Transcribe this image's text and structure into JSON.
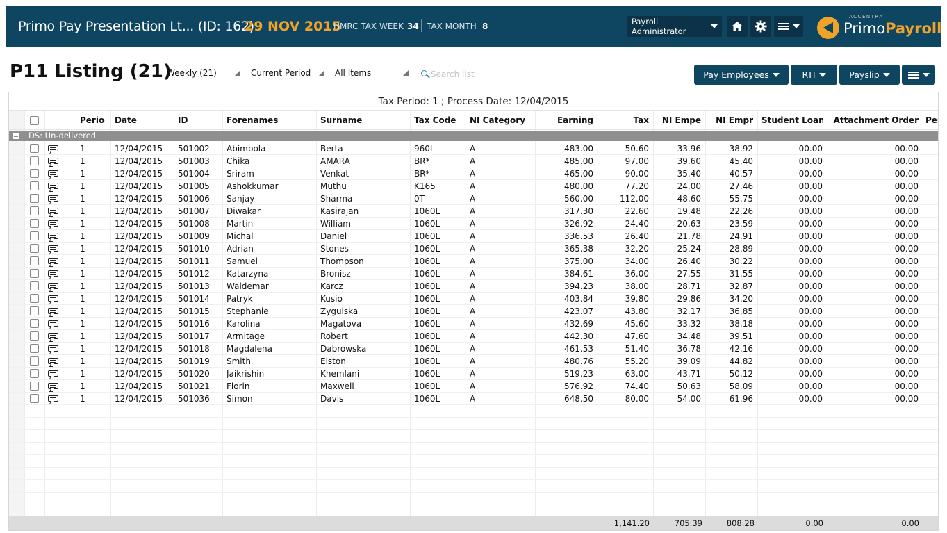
{
  "header": {
    "company": "Primo Pay Presentation Lt... (ID: 162)",
    "date": "29 NOV 2015",
    "tax_week_label": "HMRC TAX WEEK",
    "tax_week": "34",
    "tax_month_label": "TAX MONTH",
    "tax_month": "8",
    "role": "Payroll Administrator",
    "logo_sup": "ACCENTRA",
    "logo_primo": "Primo",
    "logo_payroll": "Payroll",
    "icons": {
      "home": "home-icon",
      "settings": "gear-icon",
      "menu": "menu-icon"
    }
  },
  "toolbar": {
    "title": "P11 Listing (21)",
    "filters": [
      "Weekly (21)",
      "Current Period",
      "All Items"
    ],
    "search_placeholder": "Search list",
    "buttons": {
      "pay_employees": "Pay Employees",
      "rti": "RTI",
      "payslip": "Payslip"
    }
  },
  "grid": {
    "caption": "Tax Period: 1 ; Process Date: 12/04/2015",
    "columns": [
      "Period",
      "Date",
      "ID",
      "Forenames",
      "Surname",
      "Tax Code",
      "NI Category",
      "Earning",
      "Tax",
      "NI Empe",
      "NI Empr",
      "Student Loan",
      "Attachment Order",
      "Per"
    ],
    "group": "DS: Un-delivered",
    "rows": [
      {
        "period": "1",
        "date": "12/04/2015",
        "id": "501002",
        "forenames": "Abimbola",
        "surname": "Berta",
        "tax_code": "960L",
        "ni_cat": "A",
        "earning": "483.00",
        "tax": "50.60",
        "ni_empe": "33.96",
        "ni_empr": "38.92",
        "student_loan": "00.00",
        "attachment": "00.00"
      },
      {
        "period": "1",
        "date": "12/04/2015",
        "id": "501003",
        "forenames": "Chika",
        "surname": "AMARA",
        "tax_code": "BR*",
        "ni_cat": "A",
        "earning": "485.00",
        "tax": "97.00",
        "ni_empe": "39.60",
        "ni_empr": "45.40",
        "student_loan": "00.00",
        "attachment": "00.00"
      },
      {
        "period": "1",
        "date": "12/04/2015",
        "id": "501004",
        "forenames": "Sriram",
        "surname": "Venkat",
        "tax_code": "BR*",
        "ni_cat": "A",
        "earning": "465.00",
        "tax": "90.00",
        "ni_empe": "35.40",
        "ni_empr": "40.57",
        "student_loan": "00.00",
        "attachment": "00.00"
      },
      {
        "period": "1",
        "date": "12/04/2015",
        "id": "501005",
        "forenames": "Ashokkumar",
        "surname": "Muthu",
        "tax_code": "K165",
        "ni_cat": "A",
        "earning": "480.00",
        "tax": "77.20",
        "ni_empe": "24.00",
        "ni_empr": "27.46",
        "student_loan": "00.00",
        "attachment": "00.00"
      },
      {
        "period": "1",
        "date": "12/04/2015",
        "id": "501006",
        "forenames": "Sanjay",
        "surname": "Sharma",
        "tax_code": "0T",
        "ni_cat": "A",
        "earning": "560.00",
        "tax": "112.00",
        "ni_empe": "48.60",
        "ni_empr": "55.75",
        "student_loan": "00.00",
        "attachment": "00.00"
      },
      {
        "period": "1",
        "date": "12/04/2015",
        "id": "501007",
        "forenames": "Diwakar",
        "surname": "Kasirajan",
        "tax_code": "1060L",
        "ni_cat": "A",
        "earning": "317.30",
        "tax": "22.60",
        "ni_empe": "19.48",
        "ni_empr": "22.26",
        "student_loan": "00.00",
        "attachment": "00.00"
      },
      {
        "period": "1",
        "date": "12/04/2015",
        "id": "501008",
        "forenames": "Martin",
        "surname": "William",
        "tax_code": "1060L",
        "ni_cat": "A",
        "earning": "326.92",
        "tax": "24.40",
        "ni_empe": "20.63",
        "ni_empr": "23.59",
        "student_loan": "00.00",
        "attachment": "00.00"
      },
      {
        "period": "1",
        "date": "12/04/2015",
        "id": "501009",
        "forenames": "Michal",
        "surname": "Daniel",
        "tax_code": "1060L",
        "ni_cat": "A",
        "earning": "336.53",
        "tax": "26.40",
        "ni_empe": "21.78",
        "ni_empr": "24.91",
        "student_loan": "00.00",
        "attachment": "00.00"
      },
      {
        "period": "1",
        "date": "12/04/2015",
        "id": "501010",
        "forenames": "Adrian",
        "surname": "Stones",
        "tax_code": "1060L",
        "ni_cat": "A",
        "earning": "365.38",
        "tax": "32.20",
        "ni_empe": "25.24",
        "ni_empr": "28.89",
        "student_loan": "00.00",
        "attachment": "00.00"
      },
      {
        "period": "1",
        "date": "12/04/2015",
        "id": "501011",
        "forenames": "Samuel",
        "surname": "Thompson",
        "tax_code": "1060L",
        "ni_cat": "A",
        "earning": "375.00",
        "tax": "34.00",
        "ni_empe": "26.40",
        "ni_empr": "30.22",
        "student_loan": "00.00",
        "attachment": "00.00"
      },
      {
        "period": "1",
        "date": "12/04/2015",
        "id": "501012",
        "forenames": "Katarzyna",
        "surname": "Bronisz",
        "tax_code": "1060L",
        "ni_cat": "A",
        "earning": "384.61",
        "tax": "36.00",
        "ni_empe": "27.55",
        "ni_empr": "31.55",
        "student_loan": "00.00",
        "attachment": "00.00"
      },
      {
        "period": "1",
        "date": "12/04/2015",
        "id": "501013",
        "forenames": "Waldemar",
        "surname": "Karcz",
        "tax_code": "1060L",
        "ni_cat": "A",
        "earning": "394.23",
        "tax": "38.00",
        "ni_empe": "28.71",
        "ni_empr": "32.87",
        "student_loan": "00.00",
        "attachment": "00.00"
      },
      {
        "period": "1",
        "date": "12/04/2015",
        "id": "501014",
        "forenames": "Patryk",
        "surname": "Kusio",
        "tax_code": "1060L",
        "ni_cat": "A",
        "earning": "403.84",
        "tax": "39.80",
        "ni_empe": "29.86",
        "ni_empr": "34.20",
        "student_loan": "00.00",
        "attachment": "00.00"
      },
      {
        "period": "1",
        "date": "12/04/2015",
        "id": "501015",
        "forenames": "Stephanie",
        "surname": "Zygulska",
        "tax_code": "1060L",
        "ni_cat": "A",
        "earning": "423.07",
        "tax": "43.80",
        "ni_empe": "32.17",
        "ni_empr": "36.85",
        "student_loan": "00.00",
        "attachment": "00.00"
      },
      {
        "period": "1",
        "date": "12/04/2015",
        "id": "501016",
        "forenames": "Karolina",
        "surname": "Magatova",
        "tax_code": "1060L",
        "ni_cat": "A",
        "earning": "432.69",
        "tax": "45.60",
        "ni_empe": "33.32",
        "ni_empr": "38.18",
        "student_loan": "00.00",
        "attachment": "00.00"
      },
      {
        "period": "1",
        "date": "12/04/2015",
        "id": "501017",
        "forenames": "Armitage",
        "surname": "Robert",
        "tax_code": "1060L",
        "ni_cat": "A",
        "earning": "442.30",
        "tax": "47.60",
        "ni_empe": "34.48",
        "ni_empr": "39.51",
        "student_loan": "00.00",
        "attachment": "00.00"
      },
      {
        "period": "1",
        "date": "12/04/2015",
        "id": "501018",
        "forenames": "Magdalena",
        "surname": "Dabrowska",
        "tax_code": "1060L",
        "ni_cat": "A",
        "earning": "461.53",
        "tax": "51.40",
        "ni_empe": "36.78",
        "ni_empr": "42.16",
        "student_loan": "00.00",
        "attachment": "00.00"
      },
      {
        "period": "1",
        "date": "12/04/2015",
        "id": "501019",
        "forenames": "Smith",
        "surname": "Elston",
        "tax_code": "1060L",
        "ni_cat": "A",
        "earning": "480.76",
        "tax": "55.20",
        "ni_empe": "39.09",
        "ni_empr": "44.82",
        "student_loan": "00.00",
        "attachment": "00.00"
      },
      {
        "period": "1",
        "date": "12/04/2015",
        "id": "501020",
        "forenames": "Jaikrishin",
        "surname": "Khemlani",
        "tax_code": "1060L",
        "ni_cat": "A",
        "earning": "519.23",
        "tax": "63.00",
        "ni_empe": "43.71",
        "ni_empr": "50.12",
        "student_loan": "00.00",
        "attachment": "00.00"
      },
      {
        "period": "1",
        "date": "12/04/2015",
        "id": "501021",
        "forenames": "Florin",
        "surname": "Maxwell",
        "tax_code": "1060L",
        "ni_cat": "A",
        "earning": "576.92",
        "tax": "74.40",
        "ni_empe": "50.63",
        "ni_empr": "58.09",
        "student_loan": "00.00",
        "attachment": "00.00"
      },
      {
        "period": "1",
        "date": "12/04/2015",
        "id": "501036",
        "forenames": "Simon",
        "surname": "Davis",
        "tax_code": "1060L",
        "ni_cat": "A",
        "earning": "648.50",
        "tax": "80.00",
        "ni_empe": "54.00",
        "ni_empr": "61.96",
        "student_loan": "00.00",
        "attachment": "00.00"
      }
    ],
    "totals": {
      "tax": "1,141.20",
      "ni_empe": "705.39",
      "ni_empr": "808.28",
      "student_loan": "0.00",
      "attachment": "0.00"
    }
  },
  "colors": {
    "header_bg": "#0e4560",
    "accent": "#f0a22b",
    "button_bg": "#0e4560",
    "group_bg": "#8f8f8f"
  }
}
